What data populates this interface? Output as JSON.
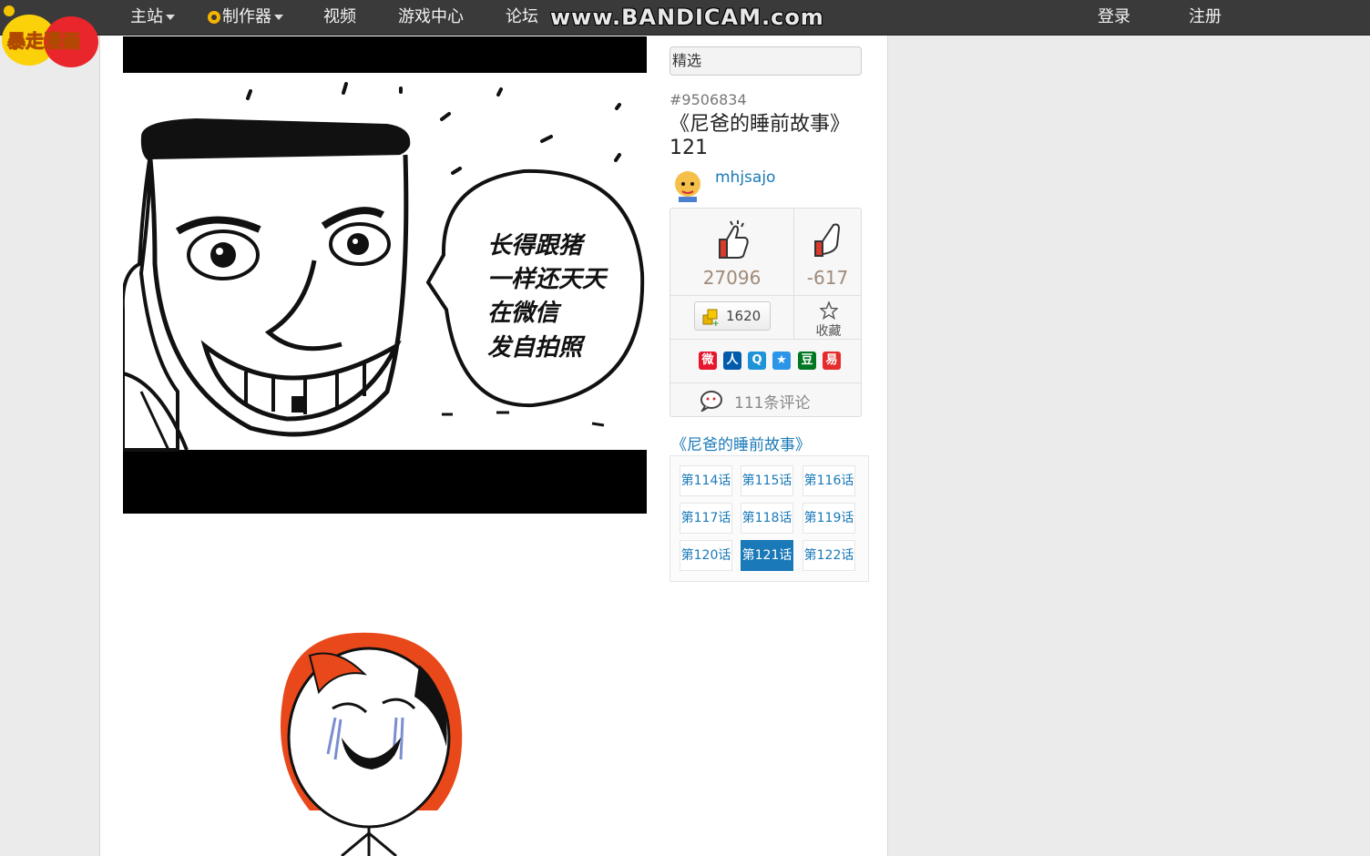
{
  "nav": {
    "logo_text": "暴走漫画",
    "items": [
      {
        "label": "主站",
        "dropdown": true
      },
      {
        "label": "制作器",
        "dropdown": true
      },
      {
        "label": "视频"
      },
      {
        "label": "游戏中心"
      },
      {
        "label": "论坛"
      }
    ],
    "watermark": "www.BANDICAM.com",
    "login": "登录",
    "register": "注册"
  },
  "comic": {
    "speech": [
      "长得跟猪",
      "一样还天天",
      "在微信",
      "发自拍照"
    ]
  },
  "sidebar": {
    "filter_value": "精选",
    "comic_id": "#9506834",
    "title": "《尼爸的睡前故事》121",
    "author": "mhjsajo",
    "upvotes": "27096",
    "downvotes": "-617",
    "coins": "1620",
    "favorite_label": "收藏",
    "share_icons": [
      {
        "name": "weibo",
        "color": "#e6162d",
        "glyph": "微"
      },
      {
        "name": "renren",
        "color": "#005baa",
        "glyph": "人"
      },
      {
        "name": "qq-space",
        "color": "#1f93d8",
        "glyph": "Q"
      },
      {
        "name": "qq-star",
        "color": "#2c95e8",
        "glyph": "★"
      },
      {
        "name": "douban",
        "color": "#007722",
        "glyph": "豆"
      },
      {
        "name": "netease",
        "color": "#e52b2b",
        "glyph": "易"
      }
    ],
    "comments": "111条评论",
    "series_title": "《尼爸的睡前故事》",
    "chapters": [
      {
        "label": "第114话",
        "active": false
      },
      {
        "label": "第115话",
        "active": false
      },
      {
        "label": "第116话",
        "active": false
      },
      {
        "label": "第117话",
        "active": false
      },
      {
        "label": "第118话",
        "active": false
      },
      {
        "label": "第119话",
        "active": false
      },
      {
        "label": "第120话",
        "active": false
      },
      {
        "label": "第121话",
        "active": true
      },
      {
        "label": "第122话",
        "active": false
      }
    ]
  }
}
